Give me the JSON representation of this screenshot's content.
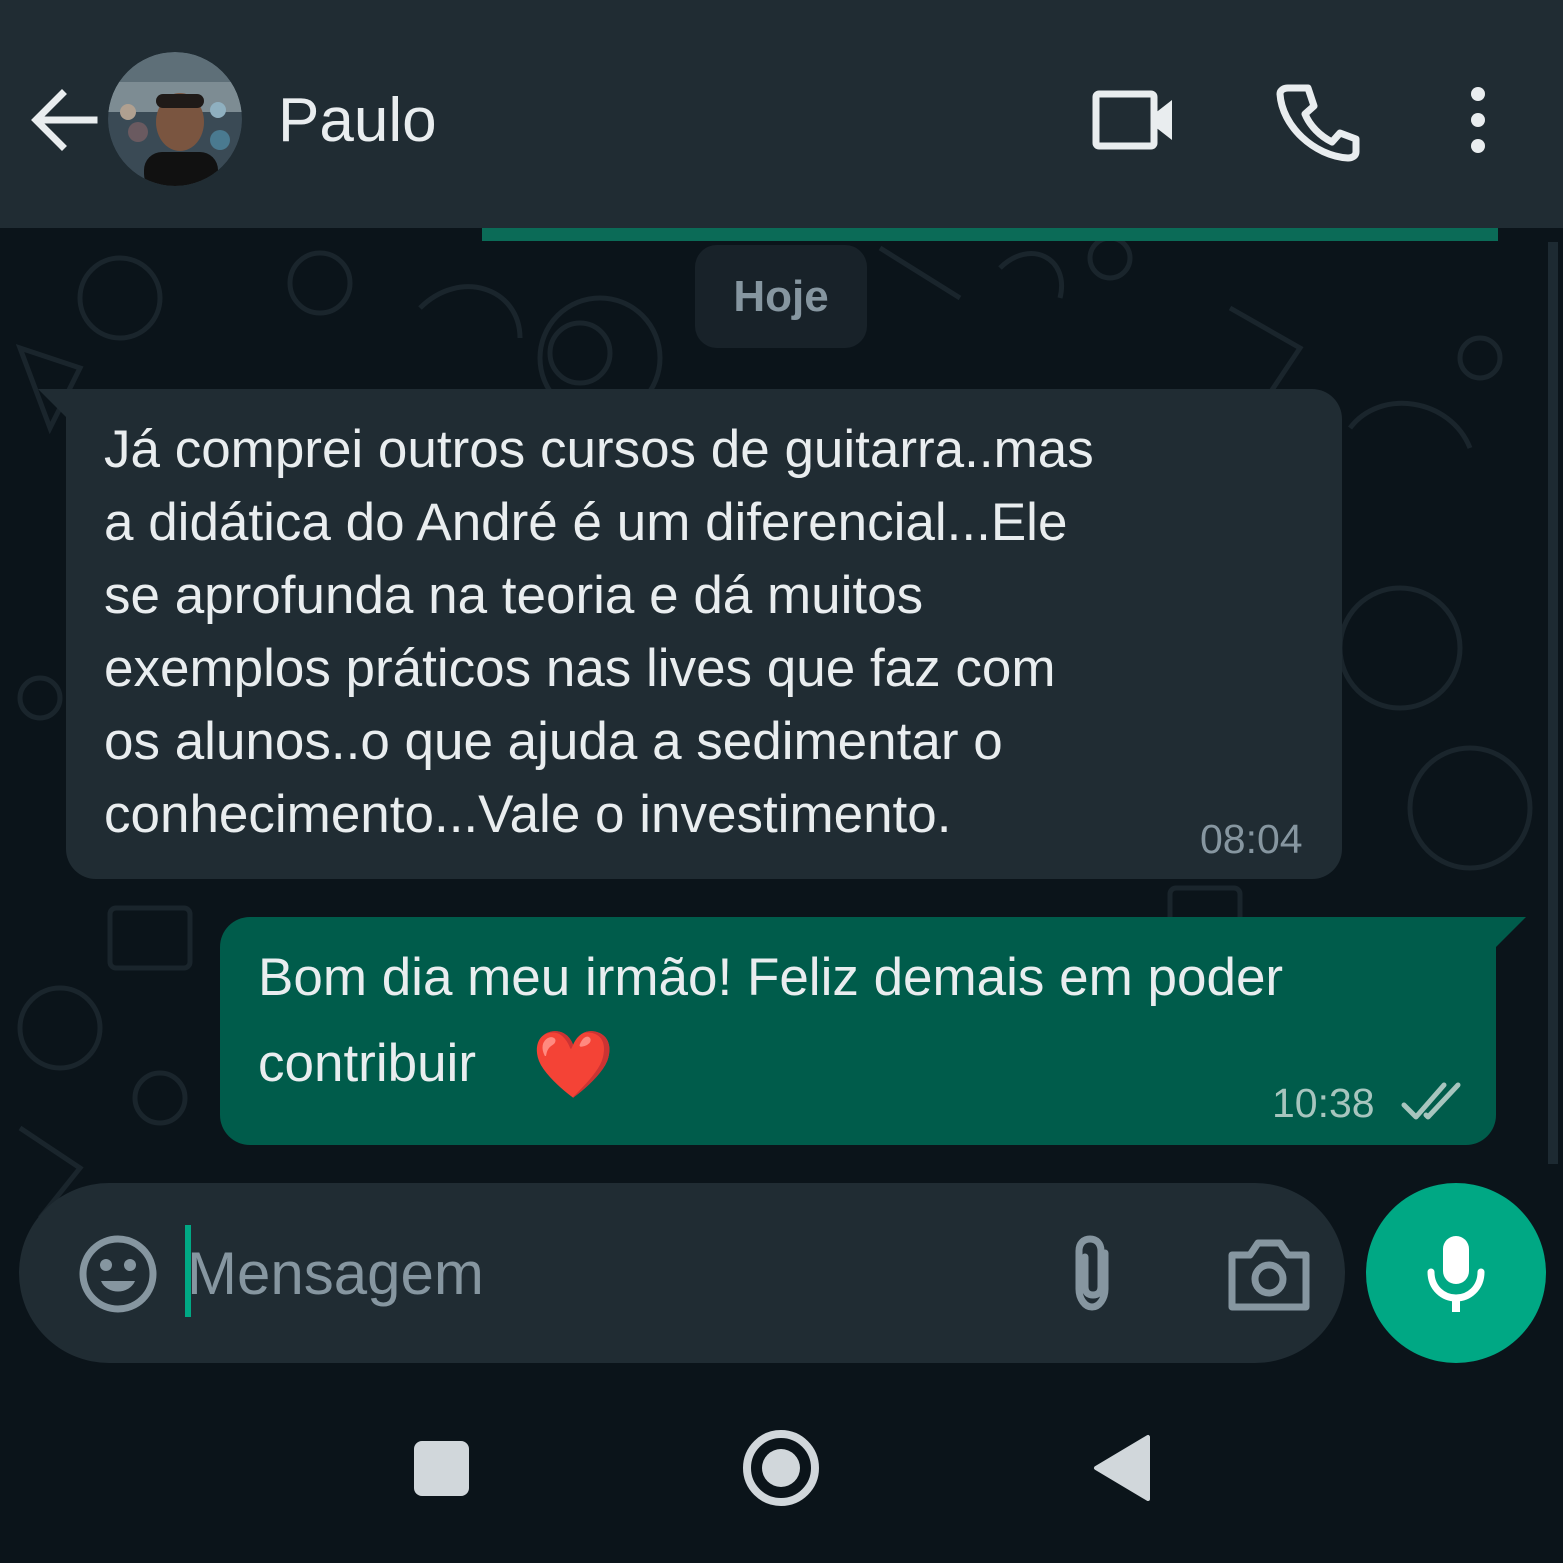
{
  "header": {
    "contact_name": "Paulo",
    "back_icon": "arrow-left-icon",
    "video_icon": "video-camera-icon",
    "call_icon": "phone-icon",
    "menu_icon": "more-vertical-icon"
  },
  "chat": {
    "date_label": "Hoje",
    "messages": [
      {
        "direction": "incoming",
        "lines": [
          "Já comprei outros cursos de guitarra..mas",
          "a didática do André é um diferencial...Ele",
          "se aprofunda na teoria e dá muitos",
          "exemplos práticos nas lives que faz com",
          "os alunos..o que ajuda a sedimentar o",
          "conhecimento...Vale o investimento."
        ],
        "time": "08:04"
      },
      {
        "direction": "outgoing",
        "lines": [
          "Bom dia meu irmão! Feliz demais em poder",
          "contribuir"
        ],
        "emoji": "❤️",
        "time": "10:38",
        "status_icon": "double-check-icon"
      }
    ]
  },
  "composer": {
    "placeholder": "Mensagem",
    "value": "",
    "emoji_icon": "smiley-icon",
    "attach_icon": "paperclip-icon",
    "camera_icon": "camera-icon",
    "mic_icon": "microphone-icon"
  },
  "navbar": {
    "recents_icon": "square-icon",
    "home_icon": "circle-icon",
    "back_icon": "triangle-back-icon"
  },
  "colors": {
    "header_bg": "#202c33",
    "chat_bg": "#0b141a",
    "incoming_bubble": "#202c33",
    "outgoing_bubble": "#005c4b",
    "accent": "#00a884"
  }
}
